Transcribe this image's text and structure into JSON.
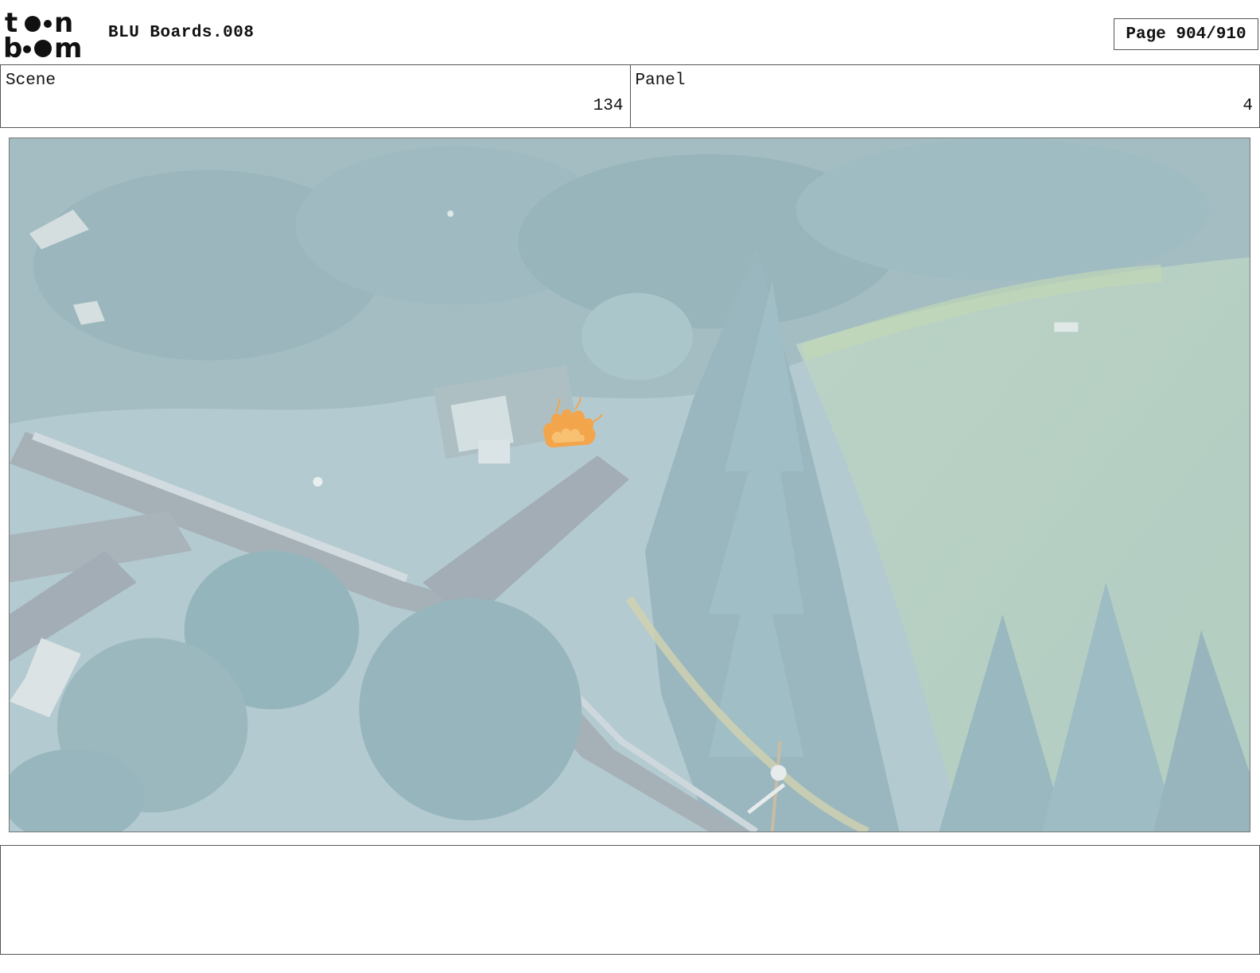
{
  "header": {
    "logo_text": "toon boom",
    "title": "BLU Boards.008",
    "page_label": "Page 904/910"
  },
  "info": {
    "scene_label": "Scene",
    "scene_value": "134",
    "panel_label": "Panel",
    "panel_value": "4"
  },
  "panel_image": {
    "icon": "aerial-forest-fire-sketch",
    "colors": {
      "haze": "#a9c4cc",
      "forest": "#7fa5ad",
      "road": "#8e9ca4",
      "field": "#a4c2b4",
      "fire": "#f08c1a"
    }
  },
  "notes": {
    "text": ""
  }
}
